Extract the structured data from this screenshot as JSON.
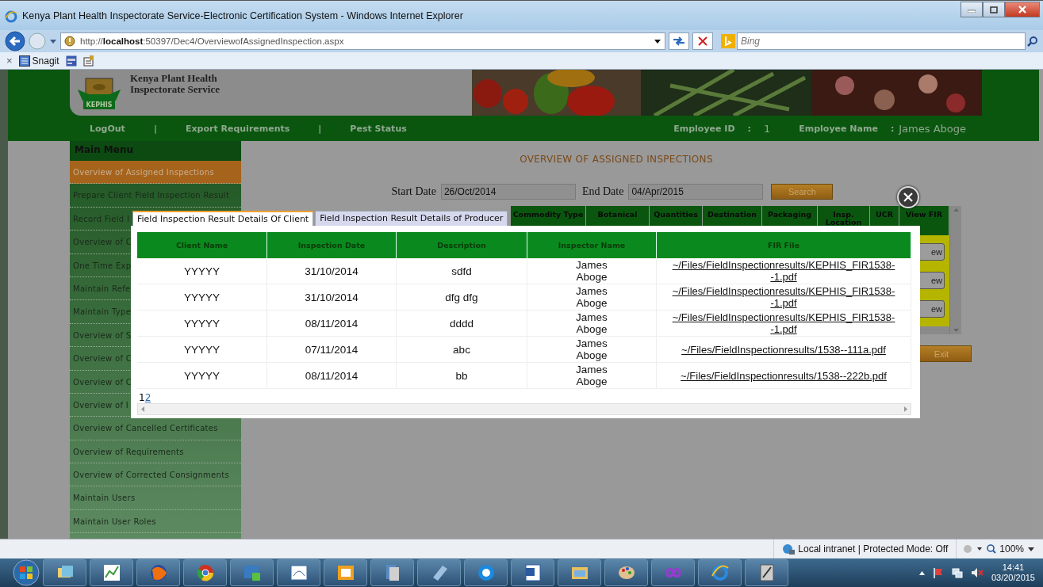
{
  "browser": {
    "title": "Kenya Plant Health Inspectorate Service-Electronic Certification System - Windows Internet Explorer",
    "address": "http://**localhost**:50397/Dec4/OverviewofAssignedInspection.aspx",
    "search_placeholder": "Bing",
    "toolbar_close": "×",
    "toolbar_items": [
      "Snagit"
    ]
  },
  "header": {
    "org_line_1": "Kenya Plant Health",
    "org_line_2": "Inspectorate Service",
    "logo_text": "KEPHIS"
  },
  "nav": {
    "links": [
      "LogOut",
      "Export Requirements",
      "Pest Status"
    ],
    "separator": "|",
    "employee_id_label": "Employee ID",
    "employee_id_colon": ":",
    "employee_id": "1",
    "employee_name_label": "Employee Name",
    "employee_name_colon": ":",
    "employee_name": "James Aboge"
  },
  "sidebar": {
    "title": "Main Menu",
    "items": [
      {
        "label": "Overview of Assigned Inspections",
        "selected": true
      },
      {
        "label": "Prepare Client Field Inspection Result",
        "selected": false
      },
      {
        "label": "Record Field I",
        "selected": false
      },
      {
        "label": "Overview of C",
        "selected": false
      },
      {
        "label": "One Time Exp",
        "selected": false
      },
      {
        "label": "Maintain Refe",
        "selected": false
      },
      {
        "label": "Maintain Type",
        "selected": false
      },
      {
        "label": "Overview of S",
        "selected": false
      },
      {
        "label": "Overview of C",
        "selected": false
      },
      {
        "label": "Overview of C",
        "selected": false
      },
      {
        "label": "Overview of I",
        "selected": false
      },
      {
        "label": "Overview of Cancelled Certificates",
        "selected": false
      },
      {
        "label": "Overview of Requirements",
        "selected": false
      },
      {
        "label": "Overview of Corrected Consignments",
        "selected": false
      },
      {
        "label": "Maintain Users",
        "selected": false
      },
      {
        "label": "Maintain User Roles",
        "selected": false
      }
    ]
  },
  "main": {
    "title": "OVERVIEW OF ASSIGNED INSPECTIONS",
    "start_label": "Start Date",
    "start_value": "26/Oct/2014",
    "end_label": "End Date",
    "end_value": "04/Apr/2015",
    "search_button": "Search",
    "grid": {
      "columns": [
        "Commodity Type",
        "Botanical",
        "Quantities",
        "Destination",
        "Packaging",
        "Insp. Location",
        "UCR",
        "View FIR"
      ],
      "row_buttons": [
        "ew",
        "ew",
        "ew"
      ]
    },
    "exit_button": "Exit"
  },
  "modal": {
    "tabs": [
      {
        "label": "Field Inspection Result Details Of Client",
        "selected": true
      },
      {
        "label": "Field Inspection Result Details of Producer",
        "selected": false
      }
    ],
    "columns": [
      "Client Name",
      "Inspection Date",
      "Description",
      "Inspector Name",
      "FIR File"
    ],
    "rows": [
      {
        "client": "YYYYY",
        "date": "31/10/2014",
        "description": "sdfd",
        "inspector": "James Aboge",
        "file": "~/Files/FieldInspectionresults/KEPHIS_FIR1538--1.pdf"
      },
      {
        "client": "YYYYY",
        "date": "31/10/2014",
        "description": "dfg dfg",
        "inspector": "James Aboge",
        "file": "~/Files/FieldInspectionresults/KEPHIS_FIR1538--1.pdf"
      },
      {
        "client": "YYYYY",
        "date": "08/11/2014",
        "description": "dddd",
        "inspector": "James Aboge",
        "file": "~/Files/FieldInspectionresults/KEPHIS_FIR1538--1.pdf"
      },
      {
        "client": "YYYYY",
        "date": "07/11/2014",
        "description": "abc",
        "inspector": "James Aboge",
        "file": "~/Files/FieldInspectionresults/1538--111a.pdf"
      },
      {
        "client": "YYYYY",
        "date": "08/11/2014",
        "description": "bb",
        "inspector": "James Aboge",
        "file": "~/Files/FieldInspectionresults/1538--222b.pdf"
      }
    ],
    "pages": [
      {
        "label": "1",
        "selected": true
      },
      {
        "label": "2",
        "selected": false
      }
    ]
  },
  "status_bar": {
    "zone": "Local intranet | Protected Mode: Off",
    "zoom": "100%"
  },
  "taskbar": {
    "time": "14:41",
    "date": "03/20/2015"
  }
}
